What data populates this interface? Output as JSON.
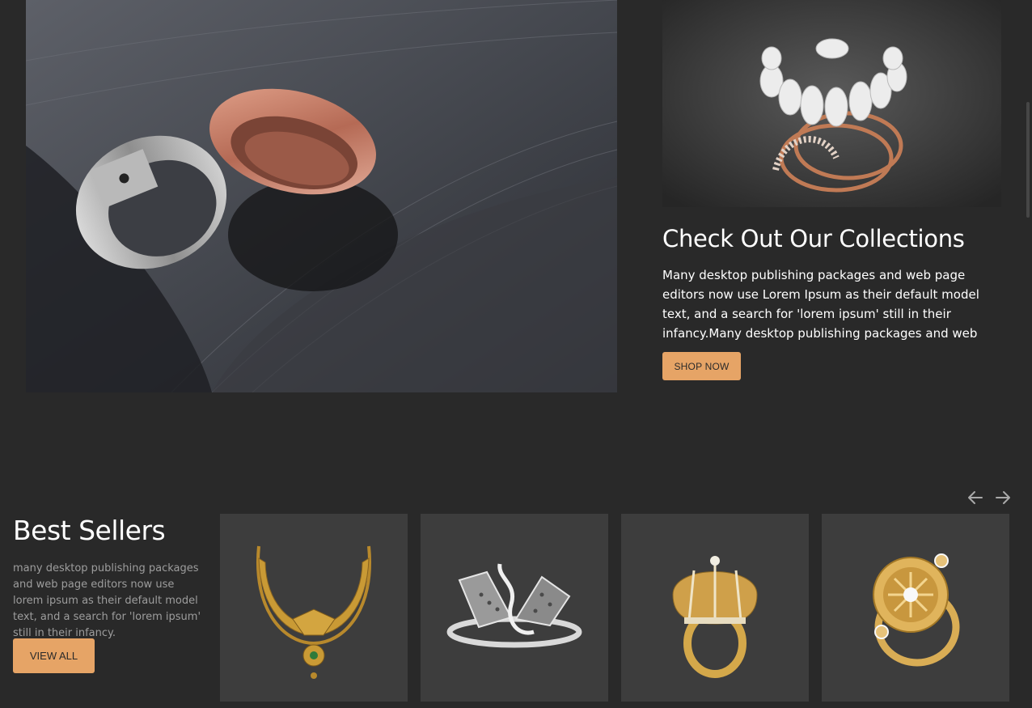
{
  "collection": {
    "title": "Check Out Our Collections",
    "description": "Many desktop publishing packages and web page editors now use Lorem Ipsum as their default model text, and a search for 'lorem ipsum' still in their infancy.Many desktop publishing packages and web page editors now use Lorem Ipsum as their",
    "button_label": "SHOP NOW"
  },
  "best_sellers": {
    "title": "Best Sellers",
    "description": "many desktop publishing packages and web page editors now use lorem ipsum as their default model text, and a search for 'lorem ipsum' still in their infancy.",
    "button_label": "VIEW ALL",
    "nav": {
      "prev_icon": "arrow-left-icon",
      "next_icon": "arrow-right-icon"
    },
    "products": [
      {
        "icon": "gold-necklace-image"
      },
      {
        "icon": "silver-swan-ring-image"
      },
      {
        "icon": "gold-crown-ring-image"
      },
      {
        "icon": "gold-sun-ring-image"
      }
    ]
  },
  "colors": {
    "background": "#292929",
    "accent": "#e6a466",
    "card": "#3d3d3d",
    "text": "#ffffff",
    "muted_text": "#9d9d9d"
  }
}
